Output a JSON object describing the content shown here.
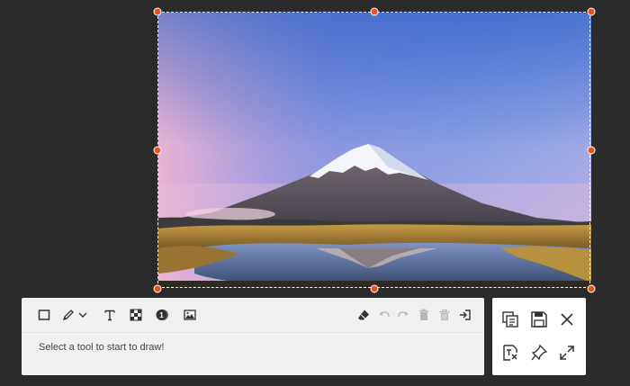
{
  "toolbar": {
    "hint_text": "Select a tool to start to draw!",
    "tools": [
      {
        "name": "rectangle-tool",
        "icon": "rectangle-icon"
      },
      {
        "name": "pencil-tool",
        "icon": "pencil-icon"
      },
      {
        "name": "pencil-options-dropdown",
        "icon": "chevron-down-icon"
      },
      {
        "name": "text-tool",
        "icon": "text-icon"
      },
      {
        "name": "mosaic-tool",
        "icon": "mosaic-icon"
      },
      {
        "name": "step-number-tool",
        "icon": "numbered-circle-icon",
        "label": "1"
      },
      {
        "name": "image-tool",
        "icon": "image-icon"
      }
    ],
    "actions": [
      {
        "name": "eraser-button",
        "icon": "eraser-icon"
      },
      {
        "name": "undo-button",
        "icon": "undo-icon"
      },
      {
        "name": "redo-button",
        "icon": "redo-icon"
      },
      {
        "name": "delete-button",
        "icon": "trash-icon"
      },
      {
        "name": "clear-all-button",
        "icon": "trash-all-icon"
      },
      {
        "name": "exit-button",
        "icon": "exit-icon"
      }
    ]
  },
  "side_panel": {
    "buttons": [
      {
        "name": "copy-button",
        "icon": "copy-icon"
      },
      {
        "name": "save-button",
        "icon": "save-icon"
      },
      {
        "name": "close-button",
        "icon": "close-icon"
      },
      {
        "name": "ocr-button",
        "icon": "text-extract-icon"
      },
      {
        "name": "pin-button",
        "icon": "pin-icon"
      },
      {
        "name": "fullscreen-button",
        "icon": "expand-icon"
      }
    ]
  },
  "colors": {
    "accent": "#e8541e",
    "background": "#2b2b2b",
    "toolbar_bg": "#f0f0f0"
  }
}
